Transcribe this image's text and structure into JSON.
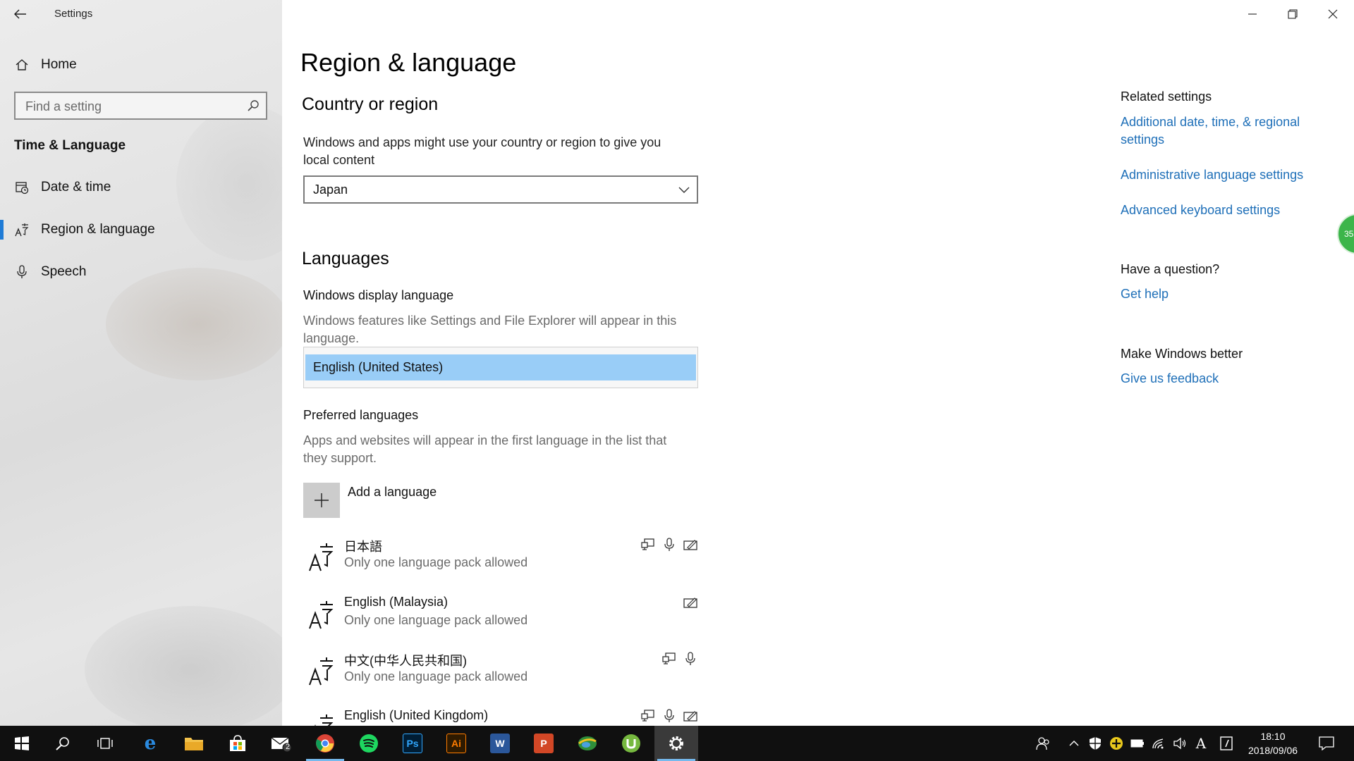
{
  "app": {
    "title": "Settings"
  },
  "sidebar": {
    "home_label": "Home",
    "search_placeholder": "Find a setting",
    "section": "Time & Language",
    "items": [
      {
        "label": "Date & time",
        "icon": "calendar-clock-icon"
      },
      {
        "label": "Region & language",
        "icon": "region-language-icon",
        "active": true
      },
      {
        "label": "Speech",
        "icon": "microphone-icon"
      }
    ]
  },
  "main": {
    "title": "Region & language",
    "country": {
      "heading": "Country or region",
      "description_line1": "Windows and apps might use your country or region to give you",
      "description_line2": "local content",
      "selected": "Japan"
    },
    "languages": {
      "heading": "Languages",
      "display_heading": "Windows display language",
      "display_desc_line1": "Windows features like Settings and File Explorer will appear in this",
      "display_desc_line2": "language.",
      "display_selected": "English (United States)",
      "preferred_heading": "Preferred languages",
      "preferred_desc_line1": "Apps and websites will appear in the first language in the list that",
      "preferred_desc_line2": "they support.",
      "add_label": "Add a language",
      "list": [
        {
          "name": "日本語",
          "status": "Only one language pack allowed",
          "features": [
            "display",
            "speech",
            "handwriting"
          ]
        },
        {
          "name": "English (Malaysia)",
          "status": "Only one language pack allowed",
          "features": [
            "handwriting"
          ]
        },
        {
          "name": "中文(中华人民共和国)",
          "status": "Only one language pack allowed",
          "features": [
            "display",
            "speech"
          ]
        },
        {
          "name": "English (United Kingdom)",
          "status": "",
          "features": [
            "display",
            "speech",
            "handwriting"
          ]
        }
      ]
    }
  },
  "related": {
    "heading": "Related settings",
    "link1_line1": "Additional date, time, & regional",
    "link1_line2": "settings",
    "link2": "Administrative language settings",
    "link3": "Advanced keyboard settings",
    "question_heading": "Have a question?",
    "help_link": "Get help",
    "better_heading": "Make Windows better",
    "feedback_link": "Give us feedback"
  },
  "badge": {
    "text": "35"
  },
  "taskbar": {
    "mail_count": "2",
    "clock_time": "18:10",
    "clock_date": "2018/09/06",
    "ime_label": "A"
  },
  "colors": {
    "accent": "#1f7bd6",
    "link": "#1e6fb8",
    "selection": "#99cdf7",
    "taskbar": "#101010"
  }
}
